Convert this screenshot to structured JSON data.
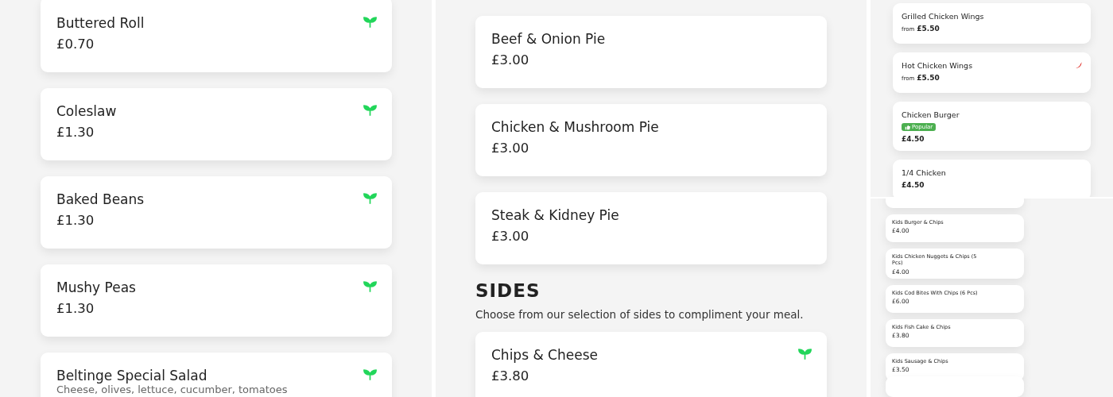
{
  "panels": [
    {
      "kind": "large",
      "items": [
        {
          "name": "Buttered Roll",
          "price": "£0.70",
          "vegetarian": true
        },
        {
          "name": "Coleslaw",
          "price": "£1.30",
          "vegetarian": true
        },
        {
          "name": "Baked Beans",
          "price": "£1.30",
          "vegetarian": true
        },
        {
          "name": "Mushy Peas",
          "price": "£1.30",
          "vegetarian": true
        },
        {
          "name": "Beltinge Special Salad",
          "description": "Cheese, olives, lettuce, cucumber, tomatoes",
          "vegetarian": true
        }
      ]
    },
    {
      "kind": "large",
      "items": [
        {
          "name": "Beef & Onion Pie",
          "price": "£3.00",
          "vegetarian": false
        },
        {
          "name": "Chicken & Mushroom Pie",
          "price": "£3.00",
          "vegetarian": false
        },
        {
          "name": "Steak & Kidney Pie",
          "price": "£3.00",
          "vegetarian": false
        }
      ],
      "section": {
        "title": "SIDES",
        "description": "Choose from our selection of sides to compliment your meal.",
        "items": [
          {
            "name": "Chips & Cheese",
            "price": "£3.80",
            "vegetarian": true
          }
        ]
      }
    },
    {
      "kind": "medium",
      "items": [
        {
          "name": "Grilled Chicken Wings",
          "price_prefix": "from",
          "price": "£5.50",
          "spicy": false
        },
        {
          "name": "Hot Chicken Wings",
          "price_prefix": "from",
          "price": "£5.50",
          "spicy": true
        },
        {
          "name": "Chicken Burger",
          "badge": "Popular",
          "price": "£4.50",
          "spicy": false
        },
        {
          "name": "1/4 Chicken",
          "price": "£4.50",
          "spicy": false
        }
      ]
    },
    {
      "kind": "small",
      "items": [
        {
          "name": "Kids Burger & Chips",
          "price": "£4.00"
        },
        {
          "name": "Kids Chicken Nuggets & Chips (5 Pcs)",
          "price": "£4.00"
        },
        {
          "name": "Kids Cod Bites With Chips (6 Pcs)",
          "price": "£6.00"
        },
        {
          "name": "Kids Fish Cake & Chips",
          "price": "£3.80"
        },
        {
          "name": "Kids Sausage & Chips",
          "price": "£3.50"
        }
      ]
    }
  ]
}
